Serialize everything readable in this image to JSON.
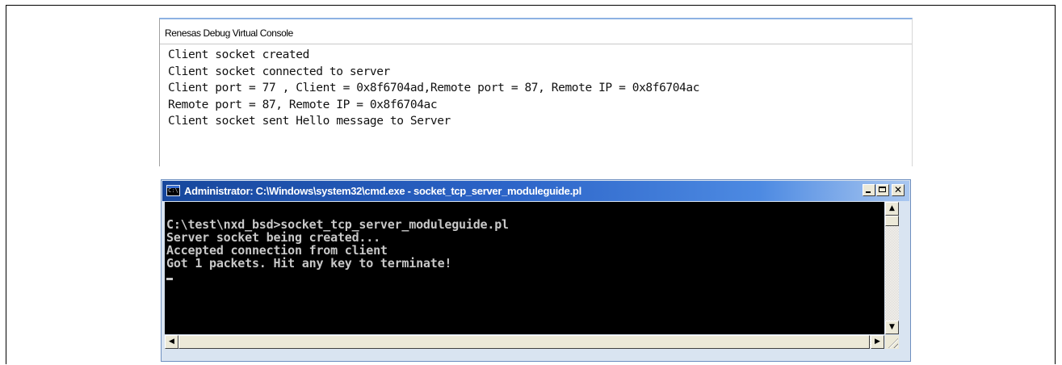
{
  "debug_console": {
    "title": "Renesas Debug Virtual Console",
    "lines": [
      "Client socket created",
      "Client socket connected to server",
      "Client port = 77 , Client = 0x8f6704ad,Remote port = 87, Remote IP = 0x8f6704ac",
      "Remote port = 87, Remote IP = 0x8f6704ac",
      "Client socket sent Hello message to Server"
    ]
  },
  "cmd_window": {
    "icon_text": "C:\\",
    "title": "Administrator: C:\\Windows\\system32\\cmd.exe - socket_tcp_server_moduleguide.pl",
    "controls": {
      "close": "✕"
    },
    "lines": [
      "C:\\test\\nxd_bsd>socket_tcp_server_moduleguide.pl",
      "Server socket being created...",
      "Accepted connection from client",
      "Got 1 packets. Hit any key to terminate!"
    ],
    "scroll": {
      "up": "▲",
      "down": "▼",
      "left": "◀",
      "right": "▶"
    }
  },
  "colors": {
    "titlebar_start": "#17479c",
    "titlebar_end": "#a9c7f0",
    "console_bg": "#000000",
    "console_fg": "#c8c8c8"
  }
}
